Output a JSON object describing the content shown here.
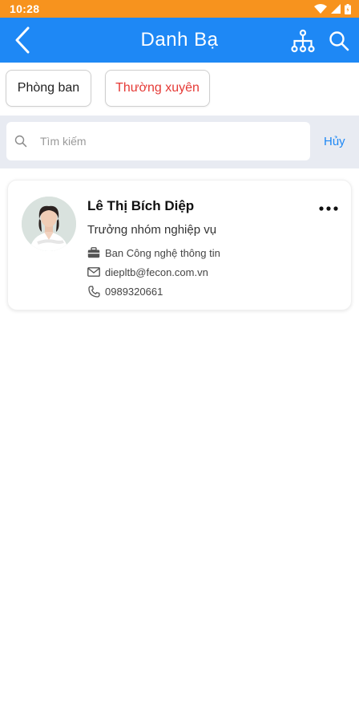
{
  "status_bar": {
    "time": "10:28"
  },
  "header": {
    "title": "Danh Bạ"
  },
  "tabs": [
    {
      "label": "Phòng ban",
      "color": "#222222"
    },
    {
      "label": "Thường xuyên",
      "color": "#e53935"
    }
  ],
  "search": {
    "placeholder": "Tìm kiếm",
    "value": "",
    "cancel_label": "Hủy"
  },
  "contacts": [
    {
      "name": "Lê Thị Bích Diệp",
      "position": "Trưởng nhóm nghiệp vụ",
      "department": "Ban Công nghệ thông tin",
      "email": "diepltb@fecon.com.vn",
      "phone": "0989320661"
    }
  ],
  "colors": {
    "status_bar": "#f7931e",
    "header": "#1e88f5",
    "accent_red": "#e53935",
    "search_area": "#e8ebf2"
  },
  "icons": [
    "back-arrow-icon",
    "org-chart-icon",
    "search-icon",
    "more-icon",
    "briefcase-icon",
    "mail-icon",
    "phone-icon",
    "wifi-icon",
    "signal-icon",
    "battery-icon"
  ]
}
